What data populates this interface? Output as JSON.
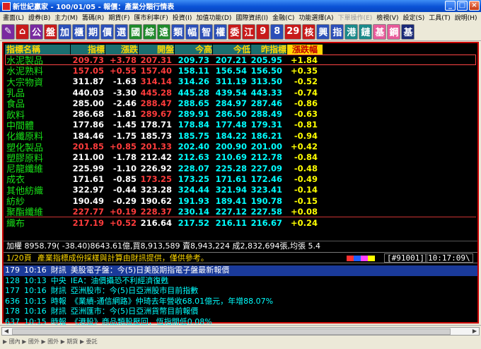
{
  "window": {
    "title": "新世紀贏家 - 100/01/05 - 報價：產業分類行情表"
  },
  "menu": [
    "畫面(L)",
    "證券(B)",
    "主力(M)",
    "籌碼(R)",
    "期貨(F)",
    "匯市利率(F)",
    "投資(I)",
    "加值功能(D)",
    "國際資訊(I)",
    "金融(C)",
    "功能選擇(A)",
    "下單操作(E)",
    "檢視(V)",
    "設定(S)",
    "工具(T)",
    "說明(H)"
  ],
  "toolbar": [
    "公",
    "盤",
    "加",
    "櫃",
    "期",
    "價",
    "選",
    "國",
    "綜",
    "遠",
    "類",
    "幅",
    "智",
    "權",
    "委",
    "江",
    "9",
    "8",
    "29",
    "核",
    "興",
    "指",
    "港",
    "鏈",
    "基",
    "鋼",
    "基"
  ],
  "headers": [
    "指標名稱",
    "指標",
    "漲跌",
    "開盤",
    "今高",
    "今低",
    "昨指標",
    "漲跌幅"
  ],
  "rows": [
    {
      "name": "水泥製品",
      "v": [
        "209.73",
        "+3.78",
        "207.31",
        "209.73",
        "207.21",
        "205.95",
        "+1.84"
      ],
      "c": [
        "up",
        "up",
        "up",
        "dn",
        "dn",
        "dn",
        "yl"
      ]
    },
    {
      "name": "水泥熟料",
      "v": [
        "157.05",
        "+0.55",
        "157.40",
        "158.11",
        "156.54",
        "156.50",
        "+0.35"
      ],
      "c": [
        "up",
        "up",
        "up",
        "dn",
        "dn",
        "dn",
        "yl"
      ]
    },
    {
      "name": "大宗物資",
      "v": [
        "311.87",
        "-1.63",
        "314.14",
        "314.26",
        "311.19",
        "313.50",
        "-0.52"
      ],
      "c": [
        "wh",
        "wh",
        "up",
        "dn",
        "dn",
        "dn",
        "yl"
      ]
    },
    {
      "name": "乳品",
      "v": [
        "440.03",
        "-3.30",
        "445.28",
        "445.28",
        "439.54",
        "443.33",
        "-0.74"
      ],
      "c": [
        "wh",
        "wh",
        "up",
        "dn",
        "dn",
        "dn",
        "yl"
      ]
    },
    {
      "name": "食品",
      "v": [
        "285.00",
        "-2.46",
        "288.47",
        "288.65",
        "284.97",
        "287.46",
        "-0.86"
      ],
      "c": [
        "wh",
        "wh",
        "up",
        "dn",
        "dn",
        "dn",
        "yl"
      ]
    },
    {
      "name": "飲料",
      "v": [
        "286.68",
        "-1.81",
        "289.67",
        "289.91",
        "286.50",
        "288.49",
        "-0.63"
      ],
      "c": [
        "wh",
        "wh",
        "up",
        "dn",
        "dn",
        "dn",
        "yl"
      ]
    },
    {
      "name": "中間體",
      "v": [
        "177.86",
        "-1.45",
        "178.71",
        "178.84",
        "177.48",
        "179.31",
        "-0.81"
      ],
      "c": [
        "wh",
        "wh",
        "wh",
        "dn",
        "dn",
        "dn",
        "yl"
      ]
    },
    {
      "name": "化纖原料",
      "v": [
        "184.46",
        "-1.75",
        "185.73",
        "185.75",
        "184.22",
        "186.21",
        "-0.94"
      ],
      "c": [
        "wh",
        "wh",
        "wh",
        "dn",
        "dn",
        "dn",
        "yl"
      ]
    },
    {
      "name": "塑化製品",
      "v": [
        "201.85",
        "+0.85",
        "201.33",
        "202.40",
        "200.90",
        "201.00",
        "+0.42"
      ],
      "c": [
        "up",
        "up",
        "up",
        "dn",
        "dn",
        "dn",
        "yl"
      ]
    },
    {
      "name": "塑膠原料",
      "v": [
        "211.00",
        "-1.78",
        "212.42",
        "212.63",
        "210.69",
        "212.78",
        "-0.84"
      ],
      "c": [
        "wh",
        "wh",
        "wh",
        "dn",
        "dn",
        "dn",
        "yl"
      ]
    },
    {
      "name": "尼龍纖維",
      "v": [
        "225.99",
        "-1.10",
        "226.92",
        "228.07",
        "225.28",
        "227.09",
        "-0.48"
      ],
      "c": [
        "wh",
        "wh",
        "wh",
        "dn",
        "dn",
        "dn",
        "yl"
      ]
    },
    {
      "name": "成衣",
      "v": [
        "171.61",
        "-0.85",
        "173.25",
        "173.25",
        "171.61",
        "172.46",
        "-0.49"
      ],
      "c": [
        "wh",
        "wh",
        "up",
        "dn",
        "dn",
        "dn",
        "yl"
      ]
    },
    {
      "name": "其他紡織",
      "v": [
        "322.97",
        "-0.44",
        "323.28",
        "324.44",
        "321.94",
        "323.41",
        "-0.14"
      ],
      "c": [
        "wh",
        "wh",
        "wh",
        "dn",
        "dn",
        "dn",
        "yl"
      ]
    },
    {
      "name": "紡紗",
      "v": [
        "190.49",
        "-0.29",
        "190.62",
        "191.93",
        "189.41",
        "190.78",
        "-0.15"
      ],
      "c": [
        "wh",
        "wh",
        "wh",
        "dn",
        "dn",
        "dn",
        "yl"
      ]
    },
    {
      "name": "聚酯纖維",
      "v": [
        "227.77",
        "+0.19",
        "228.37",
        "230.14",
        "227.12",
        "227.58",
        "+0.08"
      ],
      "c": [
        "up",
        "up",
        "up",
        "dn",
        "dn",
        "dn",
        "yl"
      ]
    },
    {
      "name": "織布",
      "v": [
        "217.19",
        "+0.52",
        "216.64",
        "217.52",
        "216.11",
        "216.67",
        "+0.24"
      ],
      "c": [
        "up",
        "up",
        "wh",
        "dn",
        "dn",
        "dn",
        "yl"
      ]
    }
  ],
  "summary": "加權 8958.79( -38.40)8643.61億,買8,913,589 賣8,943,224 成2,832,694張,均張 5.4",
  "info": {
    "page": "1/20頁",
    "note": "產業指標成份採樣與計算由財訊提供，僅供參考。",
    "code": "[#91001]",
    "clock": "10:17:09\\"
  },
  "bar_colors": [
    "#ff3030",
    "#2060ff",
    "#ff40ff",
    "#ffff00"
  ],
  "news": [
    {
      "id": "179",
      "time": "10:16",
      "src": "財訊",
      "text": "美股電子盤：今(5)日美股期指電子盤最新報價"
    },
    {
      "id": "128",
      "time": "10:13",
      "src": "中央",
      "text": "IEA：油價攝恐不利經濟復甦"
    },
    {
      "id": "177",
      "time": "10:16",
      "src": "財訊",
      "text": "亞洲股市：今(5)日亞洲股市目前指數"
    },
    {
      "id": "636",
      "time": "10:15",
      "src": "時報",
      "text": "《業績-通信網路》仲琦去年營收68.01億元，年增88.07%"
    },
    {
      "id": "178",
      "time": "10:16",
      "src": "財訊",
      "text": "亞洲匯市：今(5)日亞洲貨幣目前報價"
    },
    {
      "id": "637",
      "time": "10:15",
      "src": "時報",
      "text": "《港股》商品類股壓回，恆指開低0.08%"
    }
  ],
  "status": "▶ 國內 ▶ 國外 ▶ 國外 ▶ 期貨 ▶ 委託"
}
